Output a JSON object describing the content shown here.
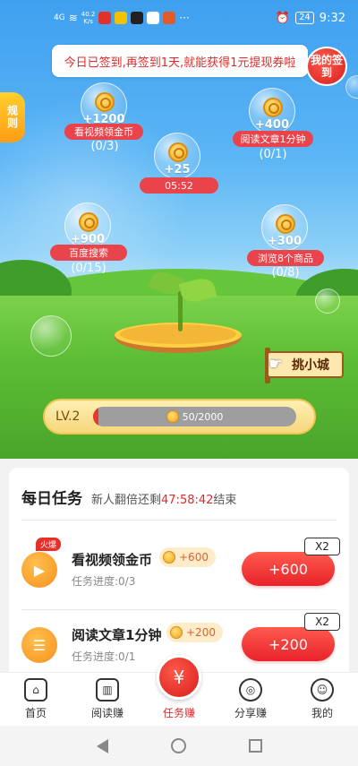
{
  "status_bar": {
    "signal": "4G",
    "net_speed": "40.2",
    "net_unit": "K/s",
    "battery": "24",
    "time": "9:32",
    "more": "···"
  },
  "banner": {
    "text": "今日已签到,再签到1天,就能获得1元提现券啦",
    "my_sign_label": "我的签到",
    "rules_label": "规则"
  },
  "bubbles": [
    {
      "amount": "+1200",
      "label": "看视频领金币",
      "progress": "(0/3)"
    },
    {
      "amount": "+400",
      "label": "阅读文章1分钟",
      "progress": "(0/1)"
    },
    {
      "amount": "+25",
      "label": "05:52"
    },
    {
      "amount": "+900",
      "label": "百度搜索",
      "progress": "(0/15)"
    },
    {
      "amount": "+300",
      "label": "浏览8个商品",
      "progress": "(0/8)"
    }
  ],
  "shop": {
    "label": "挑小城"
  },
  "level": {
    "label": "LV.2",
    "progress_text": "50/2000",
    "progress_fraction": 0.025
  },
  "daily_tasks": {
    "title": "每日任务",
    "subtitle_prefix": "新人翻倍还剩",
    "timer": "47:58:42",
    "subtitle_suffix": "结束",
    "items": [
      {
        "name": "看视频领金币",
        "reward": "+600",
        "progress": "任务进度:0/3",
        "button": "+600",
        "multiplier": "X2",
        "hot": "火爆"
      },
      {
        "name": "阅读文章1分钟",
        "reward": "+200",
        "progress": "任务进度:0/1",
        "button": "+200",
        "multiplier": "X2"
      }
    ]
  },
  "bottom_nav": [
    {
      "label": "首页",
      "icon": "home-icon"
    },
    {
      "label": "阅读赚",
      "icon": "book-icon"
    },
    {
      "label": "任务赚",
      "icon": "yuan-icon",
      "active": true,
      "center_glyph": "¥"
    },
    {
      "label": "分享赚",
      "icon": "share-icon"
    },
    {
      "label": "我的",
      "icon": "profile-icon"
    }
  ],
  "colors": {
    "accent_red": "#e8232a",
    "sky_blue": "#3fa0f0",
    "coin_gold": "#f1a31a"
  }
}
